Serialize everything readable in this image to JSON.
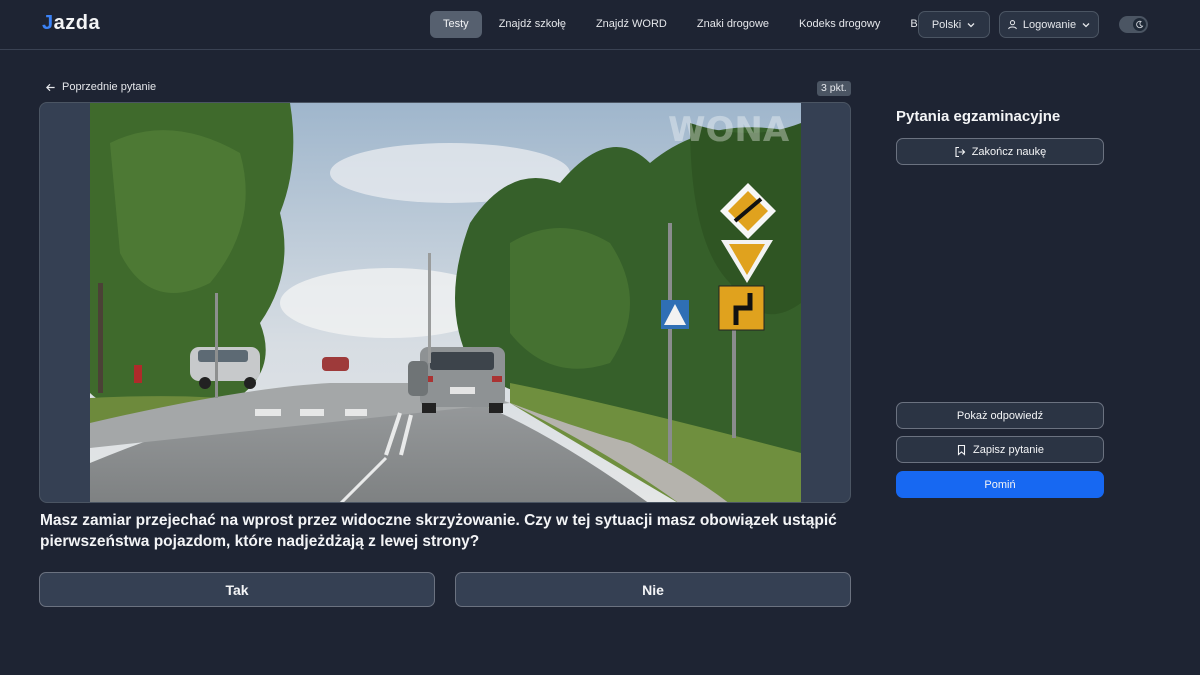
{
  "header": {
    "logo": {
      "mark": "J",
      "text": "azda"
    },
    "nav": [
      {
        "label": "Testy",
        "active": true
      },
      {
        "label": "Znajdź szkołę",
        "active": false
      },
      {
        "label": "Znajdź WORD",
        "active": false
      },
      {
        "label": "Znaki drogowe",
        "active": false
      },
      {
        "label": "Kodeks drogowy",
        "active": false
      },
      {
        "label": "Blog",
        "active": false
      }
    ],
    "language": "Polski",
    "login": "Logowanie",
    "theme_toggle_icon": "moon-icon"
  },
  "question": {
    "back_label": "Poprzednie pytanie",
    "points": "3 pkt.",
    "text": "Masz zamiar przejechać na wprost przez widoczne skrzyżowanie. Czy w tej sytuacji masz obowiązek ustąpić pierwszeństwa pojazdom, które nadjeżdżają z lewej strony?",
    "answers": [
      "Tak",
      "Nie"
    ]
  },
  "sidebar": {
    "title": "Pytania egzaminacyjne",
    "end_label": "Zakończ naukę",
    "show_answer_label": "Pokaż odpowiedź",
    "save_label": "Zapisz pytanie",
    "skip_label": "Pomiń"
  },
  "colors": {
    "background": "#1e2433",
    "accent": "#1768f2",
    "button_bg": "#2b3444"
  }
}
